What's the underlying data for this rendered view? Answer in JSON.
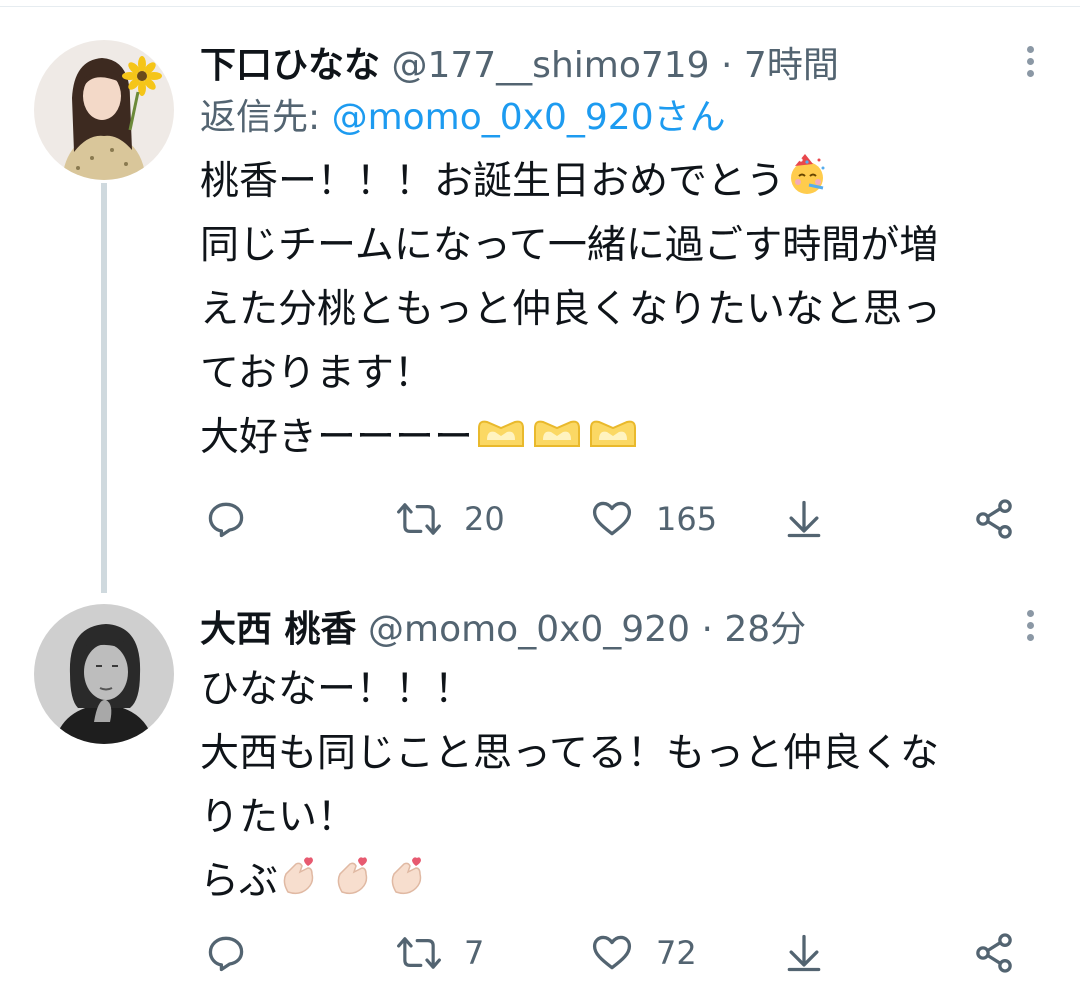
{
  "thread": [
    {
      "author_name": "下口ひなな",
      "handle": "@177__shimo719",
      "separator": "·",
      "time": "7時間",
      "reply_prefix": "返信先: ",
      "reply_mention": "@momo_0x0_920さん",
      "lines": [
        "桃香ー！！！お誕生日おめでとう",
        "同じチームになって一緒に過ごす時間が増",
        "えた分桃ともっと仲良くなりたいなと思っ",
        "ております！",
        "大好きーーーー"
      ],
      "emoji": [
        "party-face-icon",
        "heart-hands-icon"
      ],
      "retweets": "20",
      "likes": "165"
    },
    {
      "author_name": "大西 桃香",
      "handle": "@momo_0x0_920",
      "separator": "·",
      "time": "28分",
      "lines": [
        "ひななー！！！",
        "大西も同じこと思ってる！もっと仲良くな",
        "りたい！",
        "らぶ"
      ],
      "emoji": [
        "finger-heart-icon"
      ],
      "retweets": "7",
      "likes": "72"
    }
  ],
  "colors": {
    "text": "#0f1419",
    "secondary": "#536471",
    "mention": "#1d9bf0",
    "thread_line": "#cfd9de"
  }
}
